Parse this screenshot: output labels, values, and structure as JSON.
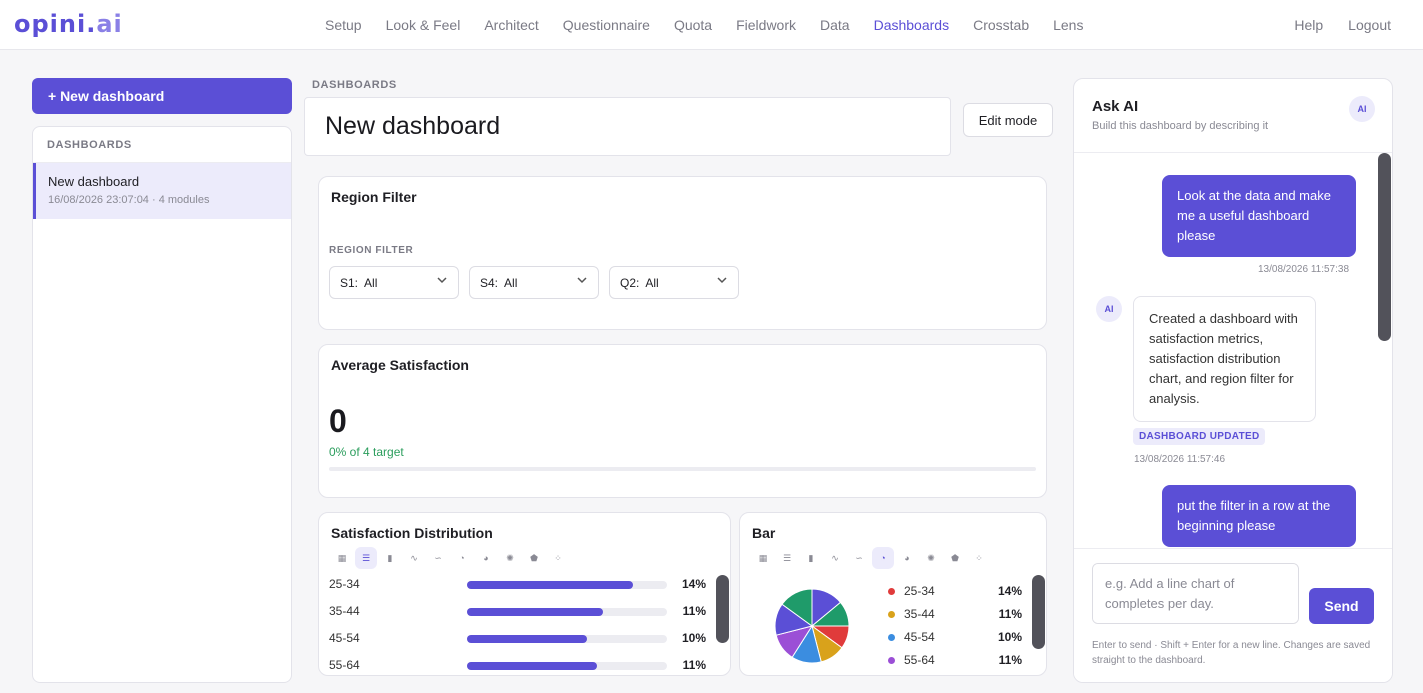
{
  "brand": {
    "logo_main": "opini.",
    "logo_ai": "ai"
  },
  "nav": {
    "items": [
      {
        "label": "Setup",
        "active": false
      },
      {
        "label": "Look & Feel",
        "active": false
      },
      {
        "label": "Architect",
        "active": false
      },
      {
        "label": "Questionnaire",
        "active": false
      },
      {
        "label": "Quota",
        "active": false
      },
      {
        "label": "Fieldwork",
        "active": false
      },
      {
        "label": "Data",
        "active": false
      },
      {
        "label": "Dashboards",
        "active": true
      },
      {
        "label": "Crosstab",
        "active": false
      },
      {
        "label": "Lens",
        "active": false
      }
    ],
    "help": "Help",
    "logout": "Logout"
  },
  "sidebar": {
    "new_button": "+ New dashboard",
    "heading": "DASHBOARDS",
    "items": [
      {
        "title": "New dashboard",
        "meta": "16/08/2026 23:07:04 · 4 modules"
      }
    ]
  },
  "main": {
    "section_label": "DASHBOARDS",
    "title": "New dashboard",
    "edit_button": "Edit mode",
    "region_filter": {
      "title": "Region Filter",
      "label": "REGION FILTER",
      "selects": [
        {
          "name": "S1:",
          "value": "All"
        },
        {
          "name": "S4:",
          "value": "All"
        },
        {
          "name": "Q2:",
          "value": "All"
        }
      ]
    },
    "kpi": {
      "title": "Average Satisfaction",
      "value": "0",
      "subtitle": "0% of 4 target",
      "progress": 0
    },
    "distribution": {
      "title": "Satisfaction Distribution",
      "rows": [
        {
          "label": "25-34",
          "pct": "14%",
          "fill": 0.83
        },
        {
          "label": "35-44",
          "pct": "11%",
          "fill": 0.68
        },
        {
          "label": "45-54",
          "pct": "10%",
          "fill": 0.6
        },
        {
          "label": "55-64",
          "pct": "11%",
          "fill": 0.65
        }
      ]
    },
    "bar_card": {
      "title": "Bar",
      "legend": [
        {
          "label": "25-34",
          "pct": "14%",
          "color": "#e03b3b"
        },
        {
          "label": "35-44",
          "pct": "11%",
          "color": "#d9a21b"
        },
        {
          "label": "45-54",
          "pct": "10%",
          "color": "#3b8de0"
        },
        {
          "label": "55-64",
          "pct": "11%",
          "color": "#9b4fd6"
        }
      ]
    }
  },
  "chart_data": {
    "type": "pie",
    "series": [
      {
        "values": [
          14,
          11,
          10,
          11,
          13,
          12,
          14,
          15
        ]
      }
    ],
    "colors": [
      "#5b4fd6",
      "#1f9b6a",
      "#e03b3b",
      "#d9a21b",
      "#3b8de0",
      "#9b4fd6",
      "#5b4fd6",
      "#1f9b6a"
    ]
  },
  "ai": {
    "title": "Ask AI",
    "subtitle": "Build this dashboard by describing it",
    "avatar": "AI",
    "messages": [
      {
        "role": "user",
        "text": "Look at the data and make me a useful dashboard please",
        "time": "13/08/2026 11:57:38"
      },
      {
        "role": "ai",
        "text": "Created a dashboard with satisfaction metrics, satisfaction distribution chart, and region filter for analysis.",
        "badge": "DASHBOARD UPDATED",
        "time": "13/08/2026 11:57:46"
      },
      {
        "role": "user",
        "text": "put the filter in a row at the beginning please"
      }
    ],
    "input_placeholder": "e.g. Add a line chart of completes per day.",
    "send": "Send",
    "hint": "Enter to send · Shift + Enter for a new line. Changes are saved straight to the dashboard."
  }
}
